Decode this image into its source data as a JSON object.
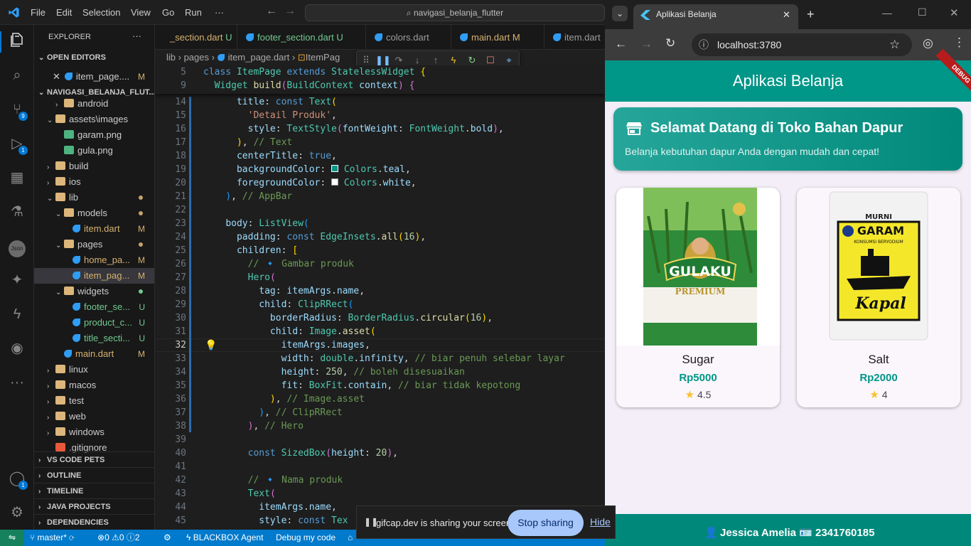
{
  "vscode": {
    "menu": [
      "File",
      "Edit",
      "Selection",
      "View",
      "Go",
      "Run",
      "···"
    ],
    "command_center": "navigasi_belanja_flutter",
    "activity_badges": {
      "source_control": "9",
      "run_debug": "1",
      "accounts": "1"
    },
    "explorer": {
      "title": "EXPLORER",
      "open_editors_label": "OPEN EDITORS",
      "open_editor": {
        "name": "item_page....",
        "status": "M"
      },
      "project_label": "NAVIGASI_BELANJA_FLUT...",
      "tree": [
        {
          "name": "android",
          "type": "folder",
          "indent": 2
        },
        {
          "name": "assets\\images",
          "type": "folder-open",
          "indent": 1
        },
        {
          "name": "garam.png",
          "type": "image",
          "indent": 2
        },
        {
          "name": "gula.png",
          "type": "image",
          "indent": 2
        },
        {
          "name": "build",
          "type": "folder",
          "indent": 1
        },
        {
          "name": "ios",
          "type": "folder",
          "indent": 1
        },
        {
          "name": "lib",
          "type": "folder-open",
          "indent": 1,
          "dot": "#c5a36b"
        },
        {
          "name": "models",
          "type": "folder-open",
          "indent": 2,
          "dot": "#c5a36b"
        },
        {
          "name": "item.dart",
          "type": "dart",
          "indent": 3,
          "status": "M"
        },
        {
          "name": "pages",
          "type": "folder-open",
          "indent": 2,
          "dot": "#c5a36b"
        },
        {
          "name": "home_pa...",
          "type": "dart",
          "indent": 3,
          "status": "M"
        },
        {
          "name": "item_pag...",
          "type": "dart",
          "indent": 3,
          "status": "M",
          "selected": true
        },
        {
          "name": "widgets",
          "type": "folder-open",
          "indent": 2,
          "dot": "#73c991"
        },
        {
          "name": "footer_se...",
          "type": "dart",
          "indent": 3,
          "status": "U"
        },
        {
          "name": "product_c...",
          "type": "dart",
          "indent": 3,
          "status": "U"
        },
        {
          "name": "title_secti...",
          "type": "dart",
          "indent": 3,
          "status": "U"
        },
        {
          "name": "main.dart",
          "type": "dart",
          "indent": 2,
          "status": "M"
        },
        {
          "name": "linux",
          "type": "folder",
          "indent": 1
        },
        {
          "name": "macos",
          "type": "folder",
          "indent": 1
        },
        {
          "name": "test",
          "type": "folder",
          "indent": 1
        },
        {
          "name": "web",
          "type": "folder",
          "indent": 1
        },
        {
          "name": "windows",
          "type": "folder",
          "indent": 1
        },
        {
          "name": ".gitignore",
          "type": "git",
          "indent": 1
        }
      ],
      "sections": [
        "VS CODE PETS",
        "OUTLINE",
        "TIMELINE",
        "JAVA PROJECTS",
        "DEPENDENCIES"
      ]
    },
    "tabs": [
      {
        "name": "_section.dart",
        "status": "U"
      },
      {
        "name": "footer_section.dart",
        "status": "U"
      },
      {
        "name": "colors.dart",
        "status": ""
      },
      {
        "name": "main.dart",
        "status": "M"
      },
      {
        "name": "item.dart",
        "status": ""
      }
    ],
    "breadcrumb": {
      "parts": [
        "lib",
        "pages",
        "item_page.dart",
        "ItemPag"
      ]
    },
    "code": {
      "sticky": [
        {
          "ln": "5",
          "html": "<span class=\"kw\">class</span> <span class=\"cls\">ItemPage</span> <span class=\"kw\">extends</span> <span class=\"cls\">StatelessWidget</span> <span class=\"br1\">{</span>"
        },
        {
          "ln": "9",
          "html": "  <span class=\"cls\">Widget</span> <span class=\"fn\">build</span><span class=\"br2\">(</span><span class=\"cls\">BuildContext</span> <span class=\"prop\">context</span><span class=\"br2\">)</span> <span class=\"br2\">{</span>"
        }
      ],
      "lines": [
        {
          "ln": "14",
          "html": "      <span class=\"prop\">title</span>: <span class=\"kw\">const</span> <span class=\"cls\">Text</span><span class=\"br1\">(</span>"
        },
        {
          "ln": "15",
          "html": "        <span class=\"str\">'Detail Produk'</span>,"
        },
        {
          "ln": "16",
          "html": "        <span class=\"prop\">style</span>: <span class=\"cls\">TextStyle</span><span class=\"br2\">(</span><span class=\"prop\">fontWeight</span>: <span class=\"cls\">FontWeight</span>.<span class=\"prop\">bold</span><span class=\"br2\">)</span>,"
        },
        {
          "ln": "17",
          "html": "      <span class=\"br1\">)</span>, <span class=\"cmt\">// Text</span>"
        },
        {
          "ln": "18",
          "html": "      <span class=\"prop\">centerTitle</span>: <span class=\"kw\">true</span>,"
        },
        {
          "ln": "19",
          "html": "      <span class=\"prop\">backgroundColor</span>: <span style=\"display:inline-block;width:10px;height:10px;background:#009688;border:1px solid #fff\"></span> <span class=\"cls\">Colors</span>.<span class=\"prop\">teal</span>,"
        },
        {
          "ln": "20",
          "html": "      <span class=\"prop\">foregroundColor</span>: <span style=\"display:inline-block;width:10px;height:10px;background:#ffffff;border:1px solid #999\"></span> <span class=\"cls\">Colors</span>.<span class=\"prop\">white</span>,"
        },
        {
          "ln": "21",
          "html": "    <span class=\"br3\">)</span>, <span class=\"cmt\">// AppBar</span>"
        },
        {
          "ln": "22",
          "html": ""
        },
        {
          "ln": "23",
          "html": "    <span class=\"prop\">body</span>: <span class=\"cls\">ListView</span><span class=\"br3\">(</span>"
        },
        {
          "ln": "24",
          "html": "      <span class=\"prop\">padding</span>: <span class=\"kw\">const</span> <span class=\"cls\">EdgeInsets</span>.<span class=\"fn\">all</span><span class=\"br1\">(</span><span class=\"num\">16</span><span class=\"br1\">)</span>,"
        },
        {
          "ln": "25",
          "html": "      <span class=\"prop\">children</span>: <span class=\"br1\">[</span>"
        },
        {
          "ln": "26",
          "html": "        <span class=\"cmt\">// 🔹 Gambar produk</span>"
        },
        {
          "ln": "27",
          "html": "        <span class=\"cls\">Hero</span><span class=\"br2\">(</span>"
        },
        {
          "ln": "28",
          "html": "          <span class=\"prop\">tag</span>: <span class=\"prop\">itemArgs</span>.<span class=\"prop\">name</span>,"
        },
        {
          "ln": "29",
          "html": "          <span class=\"prop\">child</span>: <span class=\"cls\">ClipRRect</span><span class=\"br3\">(</span>"
        },
        {
          "ln": "30",
          "html": "            <span class=\"prop\">borderRadius</span>: <span class=\"cls\">BorderRadius</span>.<span class=\"fn\">circular</span><span class=\"br1\">(</span><span class=\"num\">16</span><span class=\"br1\">)</span>,"
        },
        {
          "ln": "31",
          "html": "            <span class=\"prop\">child</span>: <span class=\"cls\">Image</span>.<span class=\"fn\">asset</span><span class=\"br1\">(</span>"
        },
        {
          "ln": "32",
          "html": "              <span class=\"prop\">itemArgs</span>.<span class=\"prop\">images</span>,"
        },
        {
          "ln": "33",
          "html": "              <span class=\"prop\">width</span>: <span class=\"cls\">double</span>.<span class=\"prop\">infinity</span>, <span class=\"cmt\">// biar penuh selebar layar</span>"
        },
        {
          "ln": "34",
          "html": "              <span class=\"prop\">height</span>: <span class=\"num\">250</span>, <span class=\"cmt\">// boleh disesuaikan</span>"
        },
        {
          "ln": "35",
          "html": "              <span class=\"prop\">fit</span>: <span class=\"cls\">BoxFit</span>.<span class=\"prop\">contain</span>, <span class=\"cmt\">// biar tidak kepotong</span>"
        },
        {
          "ln": "36",
          "html": "            <span class=\"br1\">)</span>, <span class=\"cmt\">// Image.asset</span>"
        },
        {
          "ln": "37",
          "html": "          <span class=\"br3\">)</span>, <span class=\"cmt\">// ClipRRect</span>"
        },
        {
          "ln": "38",
          "html": "        <span class=\"br2\">)</span>, <span class=\"cmt\">// Hero</span>"
        },
        {
          "ln": "39",
          "html": ""
        },
        {
          "ln": "40",
          "html": "        <span class=\"kw\">const</span> <span class=\"cls\">SizedBox</span><span class=\"br2\">(</span><span class=\"prop\">height</span>: <span class=\"num\">20</span><span class=\"br2\">)</span>,"
        },
        {
          "ln": "41",
          "html": ""
        },
        {
          "ln": "42",
          "html": "        <span class=\"cmt\">// 🔹 Nama produk</span>"
        },
        {
          "ln": "43",
          "html": "        <span class=\"cls\">Text</span><span class=\"br2\">(</span>"
        },
        {
          "ln": "44",
          "html": "          <span class=\"prop\">itemArgs</span>.<span class=\"prop\">name</span>,"
        },
        {
          "ln": "45",
          "html": "          <span class=\"prop\">style</span>: <span class=\"kw\">const</span> <span class=\"cls\">Tex</span>"
        }
      ],
      "current_line": "32"
    },
    "statusbar": {
      "branch": "master*",
      "errors": "0",
      "warnings": "0",
      "info": "2",
      "blackbox": "BLACKBOX Agent",
      "debug": "Debug my code"
    }
  },
  "browser": {
    "tab_title": "Aplikasi Belanja",
    "url": "localhost:3780",
    "app": {
      "title": "Aplikasi Belanja",
      "debug_banner": "DEBUG",
      "welcome_title": "Selamat Datang di Toko Bahan Dapur",
      "welcome_subtitle": "Belanja kebutuhan dapur Anda dengan mudah dan cepat!",
      "products": [
        {
          "name": "Sugar",
          "price": "Rp5000",
          "rating": "4.5"
        },
        {
          "name": "Salt",
          "price": "Rp2000",
          "rating": "4"
        }
      ],
      "image_text": {
        "sugar_brand": "GULAKU",
        "sugar_variant": "PREMIUM",
        "salt_top": "MURNI",
        "salt_brand": "GARAM",
        "salt_sub": "KONSUMSI BERYODIUM",
        "salt_logo": "Kapal"
      },
      "footer": {
        "name": "Jessica Amelia",
        "id": "2341760185"
      }
    }
  },
  "share_bar": {
    "message": "gifcap.dev is sharing your screen.",
    "stop": "Stop sharing",
    "hide": "Hide"
  }
}
